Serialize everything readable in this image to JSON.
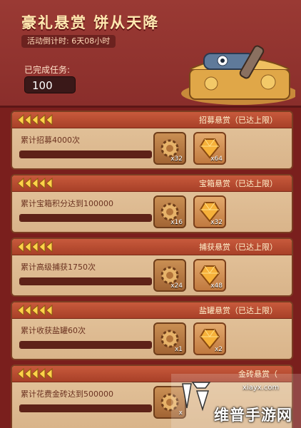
{
  "header": {
    "title": "豪礼悬赏 饼从天降",
    "countdown": "活动倒计时: 6天08小时",
    "done_label": "已完成任务:",
    "done_value": "100"
  },
  "cards": [
    {
      "title": "招募悬赏（已达上限）",
      "desc": "累计招募4000次",
      "gear_qty": "x32",
      "gem_qty": "x64",
      "progress": 1.0
    },
    {
      "title": "宝箱悬赏（已达上限）",
      "desc": "累计宝箱积分达到100000",
      "gear_qty": "x16",
      "gem_qty": "x32",
      "progress": 1.0
    },
    {
      "title": "捕获悬赏（已达上限）",
      "desc": "累计高级捕获1750次",
      "gear_qty": "x24",
      "gem_qty": "x48",
      "progress": 1.0
    },
    {
      "title": "盐罐悬赏（已达上限）",
      "desc": "累计收获盐罐60次",
      "gear_qty": "x1",
      "gem_qty": "x2",
      "progress": 1.0
    },
    {
      "title": "金砖悬赏（",
      "desc": "累计花费金砖达到500000",
      "gear_qty": "x",
      "gem_qty": "",
      "progress": 1.0
    }
  ],
  "watermark": {
    "url": "xiayx.com",
    "text": "维普手游网"
  },
  "colors": {
    "background": "#7a1f1d",
    "card": "#e4c49c",
    "card_header": "#c85a3c",
    "title_text": "#ffe8b0"
  }
}
